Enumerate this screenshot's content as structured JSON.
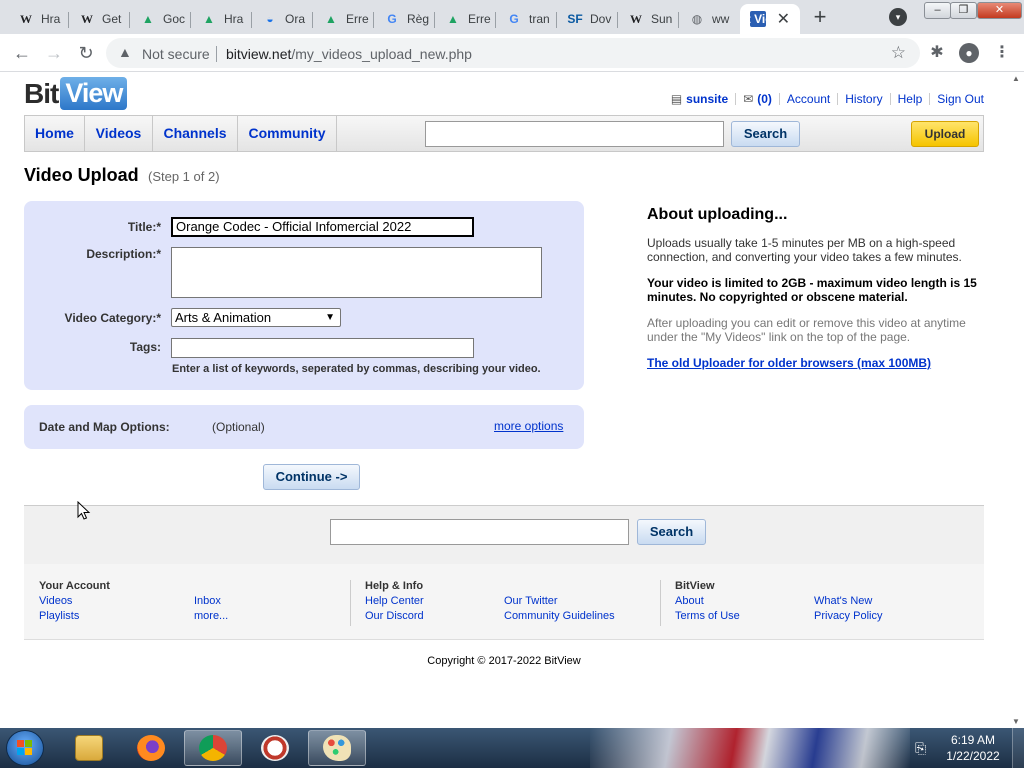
{
  "browser": {
    "tabs": [
      {
        "label": "Hra",
        "favicon": "wikipedia-icon"
      },
      {
        "label": "Get",
        "favicon": "wikipedia-icon"
      },
      {
        "label": "Goc",
        "favicon": "google-drive-icon"
      },
      {
        "label": "Hra",
        "favicon": "google-drive-icon"
      },
      {
        "label": "Ora",
        "favicon": "orange-codec-icon"
      },
      {
        "label": "Erre",
        "favicon": "google-drive-icon"
      },
      {
        "label": "Règ",
        "favicon": "google-icon"
      },
      {
        "label": "Erre",
        "favicon": "google-drive-icon"
      },
      {
        "label": "tran",
        "favicon": "google-icon"
      },
      {
        "label": "Dov",
        "favicon": "sourceforge-icon"
      },
      {
        "label": "Sun",
        "favicon": "wikipedia-icon"
      },
      {
        "label": "ww",
        "favicon": "globe-icon"
      }
    ],
    "active_tab_favicon_text": "Bit View",
    "new_tab": "+",
    "security": "Not secure",
    "url_host": "bitview.net",
    "url_path": "/my_videos_upload_new.php"
  },
  "site": {
    "logo_bit": "Bit",
    "logo_view": "View",
    "user": {
      "username": "sunsite",
      "inbox_count": "(0)",
      "links": [
        "Account",
        "History",
        "Help",
        "Sign Out"
      ]
    },
    "nav": {
      "tabs": [
        "Home",
        "Videos",
        "Channels",
        "Community"
      ],
      "search_button": "Search",
      "upload_button": "Upload"
    }
  },
  "upload": {
    "title": "Video Upload",
    "step": "(Step 1 of 2)",
    "form": {
      "title_label": "Title:*",
      "title_value": "Orange Codec - Official Infomercial 2022",
      "description_label": "Description:*",
      "category_label": "Video Category:*",
      "category_value": "Arts & Animation",
      "tags_label": "Tags:",
      "tags_hint": "Enter a list of keywords, seperated by commas, describing your video."
    },
    "date_map": {
      "label": "Date and Map Options:",
      "optional": "(Optional)",
      "more_options": "more options"
    },
    "continue_button": "Continue ->"
  },
  "about": {
    "title": "About uploading...",
    "p1": "Uploads usually take 1-5 minutes per MB on a high-speed connection, and converting your video takes a few minutes.",
    "p2": "Your video is limited to 2GB - maximum video length is 15 minutes. No copyrighted or obscene material.",
    "p3": "After uploading you can edit or remove this video at anytime under the \"My Videos\" link on the top of the page.",
    "old_uploader": "The old Uploader for older browsers (max 100MB)"
  },
  "footer": {
    "search_button": "Search",
    "columns": [
      {
        "heading": "Your Account",
        "links": [
          "Videos",
          "Playlists",
          "Inbox",
          "more..."
        ]
      },
      {
        "heading": "Help & Info",
        "links": [
          "Help Center",
          "Our Discord",
          "Our Twitter",
          "Community Guidelines"
        ]
      },
      {
        "heading": "BitView",
        "links": [
          "About",
          "Terms of Use",
          "What's New",
          "Privacy Policy"
        ]
      }
    ],
    "copyright": "Copyright © 2017-2022 BitView"
  },
  "taskbar": {
    "time": "6:19 AM",
    "date": "1/22/2022"
  },
  "colors": {
    "link": "#0033cc",
    "panel": "#e0e4fb",
    "upload_button": "#f5c400"
  }
}
